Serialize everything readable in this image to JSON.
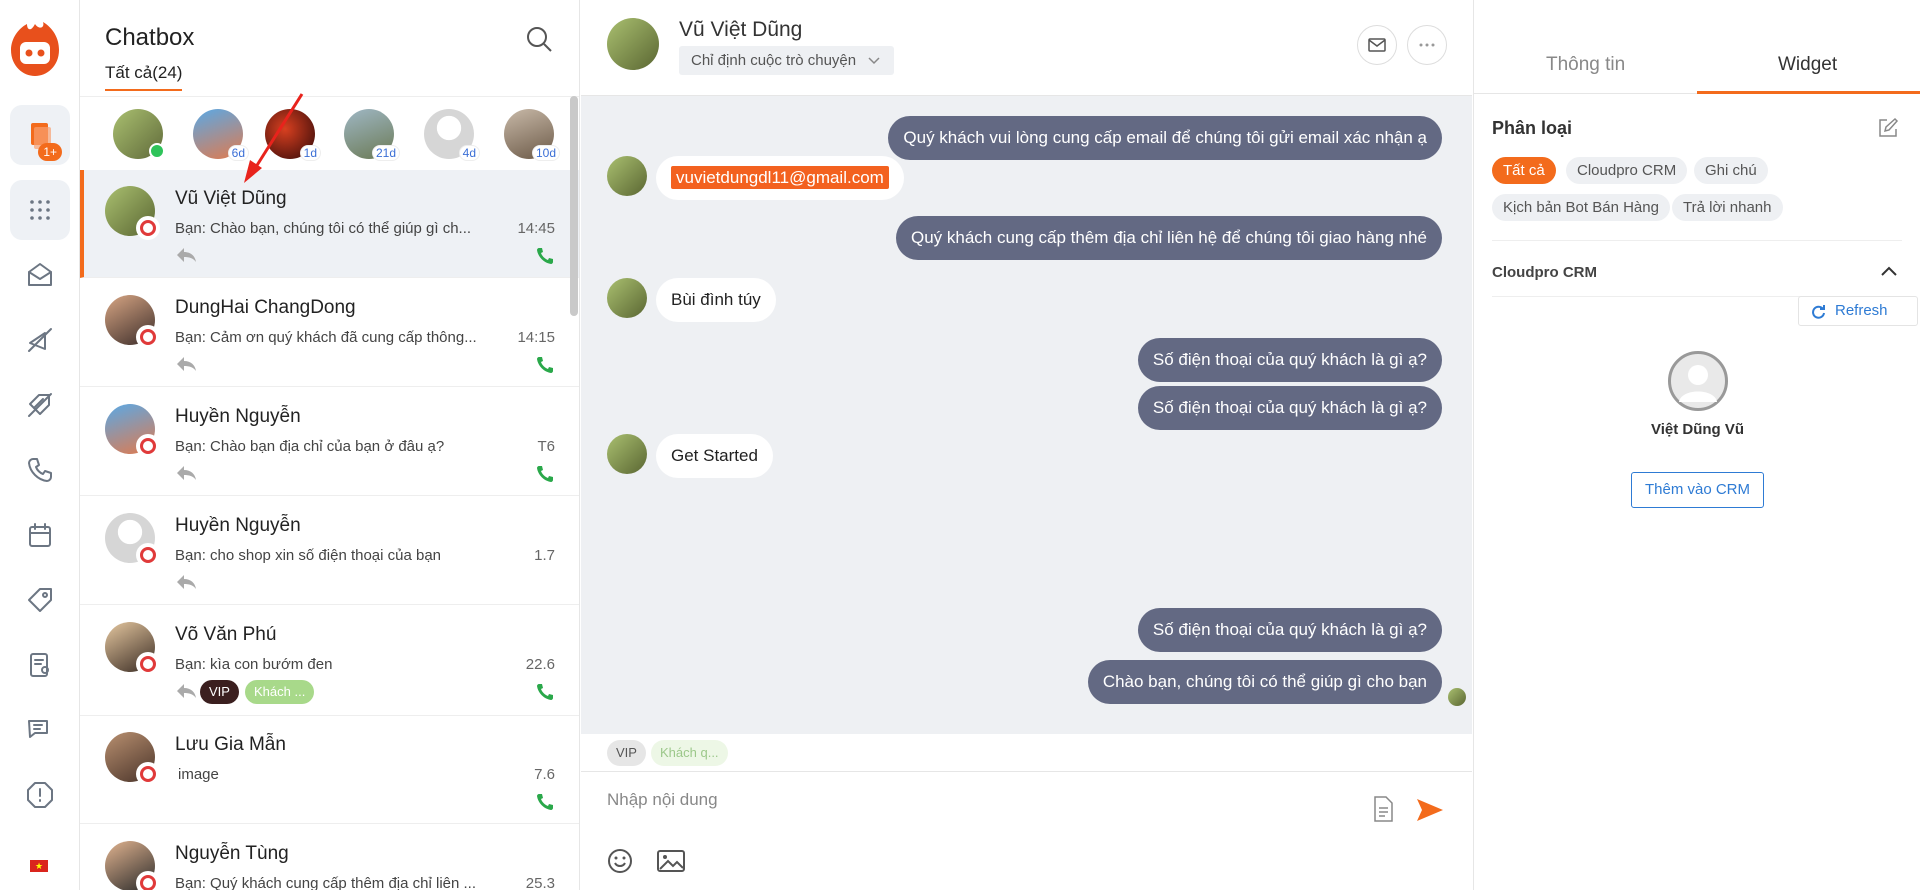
{
  "nav": {
    "badge": "1+"
  },
  "list": {
    "title": "Chatbox",
    "tab_all": "Tất cả(24)",
    "stories": [
      {
        "ago": ""
      },
      {
        "ago": "6d"
      },
      {
        "ago": "1d"
      },
      {
        "ago": "21d"
      },
      {
        "ago": "4d"
      },
      {
        "ago": "10d"
      }
    ],
    "conversations": [
      {
        "name": "Vũ Việt Dũng",
        "msg": "Bạn: Chào bạn, chúng tôi có thể giúp gì ch...",
        "time": "14:45"
      },
      {
        "name": "DungHai ChangDong",
        "msg": "Bạn: Cảm ơn quý khách đã cung cấp thông...",
        "time": "14:15"
      },
      {
        "name": "Huyền Nguyễn",
        "msg": "Bạn: Chào bạn địa chỉ của bạn ở đâu ạ?",
        "time": "T6"
      },
      {
        "name": "Huyền Nguyễn",
        "msg": "Bạn: cho shop xin số điện thoại của bạn",
        "time": "1.7"
      },
      {
        "name": "Võ Văn Phú",
        "msg": "Bạn: kìa con bướm đen",
        "time": "22.6",
        "tags": [
          "VIP",
          "Khách ..."
        ]
      },
      {
        "name": "Lưu Gia Mẫn",
        "msg": "image",
        "time": "7.6"
      },
      {
        "name": "Nguyễn Tùng",
        "msg": "Bạn: Quý khách cung cấp thêm địa chỉ liên ...",
        "time": "25.3"
      }
    ]
  },
  "chat": {
    "name": "Vũ Việt Dũng",
    "assign_label": "Chỉ định cuộc trò chuyện",
    "messages": {
      "m1": "Quý khách vui lòng cung cấp email để chúng tôi gửi email xác nhận ạ",
      "m2": "vuvietdungdl11@gmail.com",
      "m3": "Quý khách cung cấp thêm địa chỉ liên hệ để chúng tôi giao hàng nhé",
      "m4": "Bùi đình túy",
      "m5": "Số điện thoại của quý khách là gì ạ?",
      "m6": "Số điện thoại của quý khách là gì ạ?",
      "m7": "Get Started",
      "m8": "Số điện thoại của quý khách là gì ạ?",
      "m9": "Chào bạn, chúng tôi có thể giúp gì cho bạn"
    },
    "tags": [
      "VIP",
      "Khách q..."
    ],
    "input_placeholder": "Nhập nội dung"
  },
  "right": {
    "tab_info": "Thông tin",
    "tab_widget": "Widget",
    "section_title": "Phân loại",
    "chips": [
      "Tất cả",
      "Cloudpro CRM",
      "Ghi chú",
      "Kịch bản Bot Bán Hàng",
      "Trả lời nhanh"
    ],
    "crm_title": "Cloudpro CRM",
    "refresh": "Refresh",
    "contact_name": "Việt Dũng Vũ",
    "add_crm": "Thêm vào CRM"
  },
  "colors": {
    "accent": "#f36b1c",
    "bubble_out": "#636983",
    "link": "#2e7bd4"
  }
}
